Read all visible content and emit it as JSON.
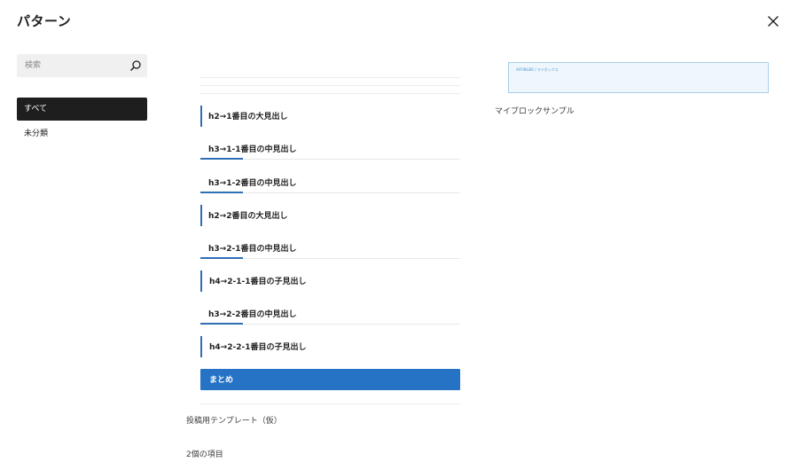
{
  "modal": {
    "title": "パターン"
  },
  "search": {
    "placeholder": "検索",
    "value": ""
  },
  "categories": [
    {
      "label": "すべて",
      "selected": true
    },
    {
      "label": "未分類",
      "selected": false
    }
  ],
  "patterns": [
    {
      "title": "投稿用テンプレート（仮）",
      "blocks": [
        {
          "level": "h2",
          "text": "h2→1番目の大見出し"
        },
        {
          "level": "h3",
          "text": "h3→1-1番目の中見出し"
        },
        {
          "level": "h3",
          "text": "h3→1-2番目の中見出し"
        },
        {
          "level": "h2",
          "text": "h2→2番目の大見出し"
        },
        {
          "level": "h3",
          "text": "h3→2-1番目の中見出し"
        },
        {
          "level": "h4",
          "text": "h4→2-1-1番目の子見出し"
        },
        {
          "level": "h3",
          "text": "h3→2-2番目の中見出し"
        },
        {
          "level": "h4",
          "text": "h4→2-2-1番目の子見出し"
        },
        {
          "level": "summary",
          "text": "まとめ"
        }
      ]
    },
    {
      "title": "マイブロックサンプル",
      "preview_text": "AFFINGER / マイボックス"
    }
  ],
  "count": "2個の項目",
  "colors": {
    "accent": "#2672c5",
    "heading_bar": "#2f6fb5",
    "selected_bg": "#1e1e1e"
  }
}
